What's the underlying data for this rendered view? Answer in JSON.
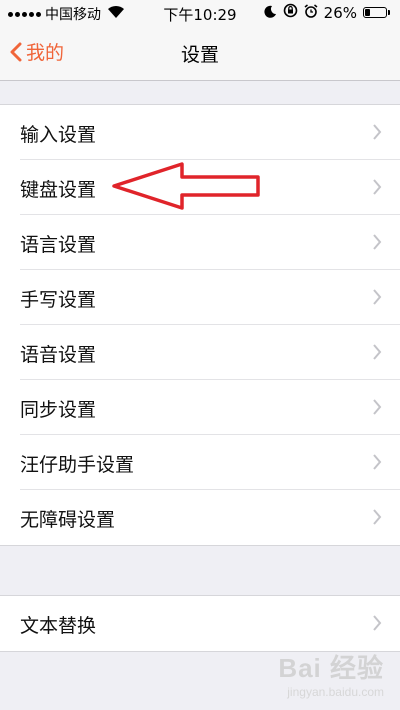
{
  "status_bar": {
    "carrier": "中国移动",
    "time": "下午10:29",
    "battery_percent_text": "26%",
    "battery_level": 0.26
  },
  "nav": {
    "back_label": "我的",
    "title": "设置"
  },
  "settings_group_1": [
    {
      "label": "输入设置"
    },
    {
      "label": "键盘设置"
    },
    {
      "label": "语言设置"
    },
    {
      "label": "手写设置"
    },
    {
      "label": "语音设置"
    },
    {
      "label": "同步设置"
    },
    {
      "label": "汪仔助手设置"
    },
    {
      "label": "无障碍设置"
    }
  ],
  "settings_group_2": [
    {
      "label": "文本替换"
    }
  ],
  "annotation": {
    "color": "#e0242a",
    "target": "键盘设置"
  },
  "watermark": {
    "brand": "Bai 经验",
    "sub": "jingyan.baidu.com"
  },
  "colors": {
    "accent": "#f0653a"
  }
}
